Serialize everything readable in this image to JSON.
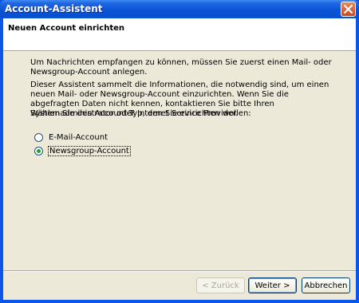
{
  "window": {
    "title": "Account-Assistent"
  },
  "header": {
    "title": "Neuen Account einrichten"
  },
  "content": {
    "paragraph1": "Um Nachrichten empfangen zu können, müssen Sie zuerst einen Mail- oder Newsgroup-Account anlegen.",
    "paragraph2": "Dieser Assistent sammelt die Informationen, die notwendig sind, um einen neuen Mail- oder Newsgroup-Account einzurichten. Wenn Sie die abgefragten Daten nicht kennen, kontaktieren Sie bitte Ihren Systemadministrator oder Internet Service Provider.",
    "prompt": "Wählen Sie den Account-Typ, den Sie einrichten wollen:"
  },
  "options": [
    {
      "label": "E-Mail-Account",
      "selected": false
    },
    {
      "label": "Newsgroup-Account",
      "selected": true
    }
  ],
  "buttons": {
    "back": "< Zurück",
    "next": "Weiter >",
    "cancel": "Abbrechen"
  },
  "colors": {
    "titlebar": "#0a54d6",
    "dialog_bg": "#ece9d8",
    "close_button": "#c9491b",
    "radio_check": "#21a121"
  }
}
